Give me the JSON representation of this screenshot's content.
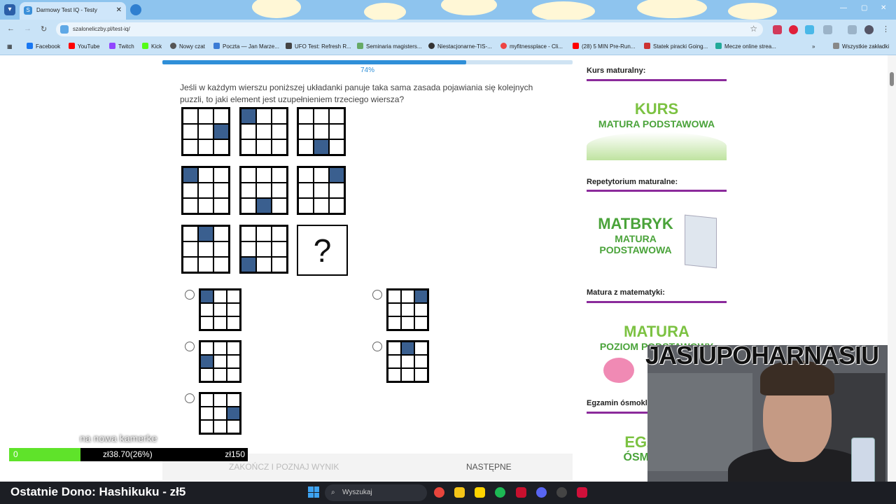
{
  "browser": {
    "tab_title": "Darmowy Test IQ - Testy",
    "tab_close": "✕",
    "url": "szaloneliczby.pl/test-iq/",
    "bookmarks": [
      "Facebook",
      "YouTube",
      "Twitch",
      "Kick",
      "Nowy czat",
      "Poczta — Jan Marze...",
      "UFO Test: Refresh R...",
      "Seminaria magisters...",
      "Niestacjonarne-TIS-...",
      "myfitnessplace - Cli...",
      "(28) 5 MIN Pre-Run...",
      "Statek piracki Going...",
      "Mecze online strea..."
    ],
    "bookmarks_all": "Wszystkie zakładki"
  },
  "test": {
    "progress_label": "74%",
    "progress_value": 0.74,
    "question": "Jeśli w każdym wierszu poniższej układanki panuje taka sama zasada pojawiania się kolejnych puzzli, to jaki element jest uzupełnieniem trzeciego wiersza?",
    "question_mark": "?",
    "finish_label": "ZAKOŃCZ I POZNAJ WYNIK",
    "next_label": "NASTĘPNE"
  },
  "sidebar": {
    "section1_title": "Kurs maturalny:",
    "ad1_line1": "KURS",
    "ad1_line2": "MATURA PODSTAWOWA",
    "section2_title": "Repetytorium maturalne:",
    "ad2_line1": "MATBRYK",
    "ad2_line2": "MATURA",
    "ad2_line3": "PODSTAWOWA",
    "section3_title": "Matura z matematyki:",
    "ad3_line1": "MATURA",
    "ad3_line2": "POZIOM PODSTAWOWY",
    "section4_title": "Egzamin ósmokl",
    "ad4_line1": "EGZ",
    "ad4_line2": "ÓSMO"
  },
  "stream": {
    "banner": "JASIUPOHARNASIU",
    "camera_label": "na nowa kamerke",
    "donate_current_num": "0",
    "donate_amount": "zł38.70(26%)",
    "donate_goal": "zł150",
    "donate_fraction": 0.26,
    "last_donate": "Ostatnie Dono: Hashikuku - zł5"
  },
  "taskbar": {
    "search_placeholder": "Wyszukaj"
  }
}
